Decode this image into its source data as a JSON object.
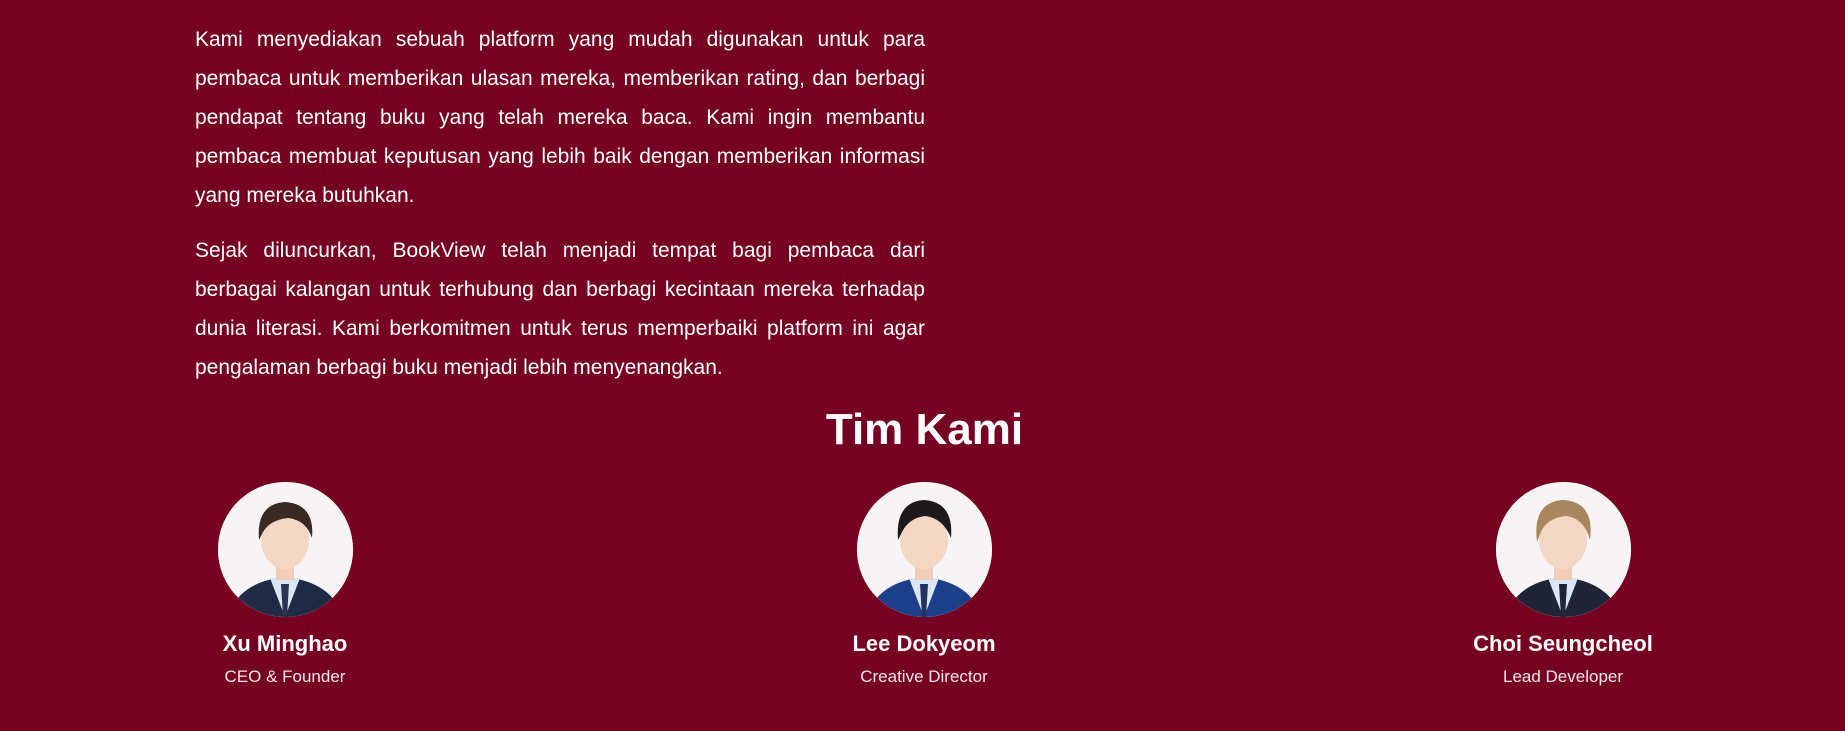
{
  "about": {
    "paragraphs": [
      "Kami menyediakan sebuah platform yang mudah digunakan untuk para pembaca untuk memberikan ulasan mereka, memberikan rating, dan berbagi pendapat tentang buku yang telah mereka baca. Kami ingin membantu pembaca membuat keputusan yang lebih baik dengan memberikan informasi yang mereka butuhkan.",
      "Sejak diluncurkan, BookView telah menjadi tempat bagi pembaca dari berbagai kalangan untuk terhubung dan berbagi kecintaan mereka terhadap dunia literasi. Kami berkomitmen untuk terus memperbaiki platform ini agar pengalaman berbagi buku menjadi lebih menyenangkan."
    ]
  },
  "team": {
    "title": "Tim Kami",
    "members": [
      {
        "name": "Xu Minghao",
        "role": "CEO & Founder",
        "hair_color": "#3a2a26",
        "suit_color": "#1f2a44"
      },
      {
        "name": "Lee Dokyeom",
        "role": "Creative Director",
        "hair_color": "#1e1a1c",
        "suit_color": "#1d3f8a"
      },
      {
        "name": "Choi Seungcheol",
        "role": "Lead Developer",
        "hair_color": "#a8875f",
        "suit_color": "#1f2436"
      }
    ]
  },
  "colors": {
    "background": "#750022",
    "text": "#ffffff"
  }
}
